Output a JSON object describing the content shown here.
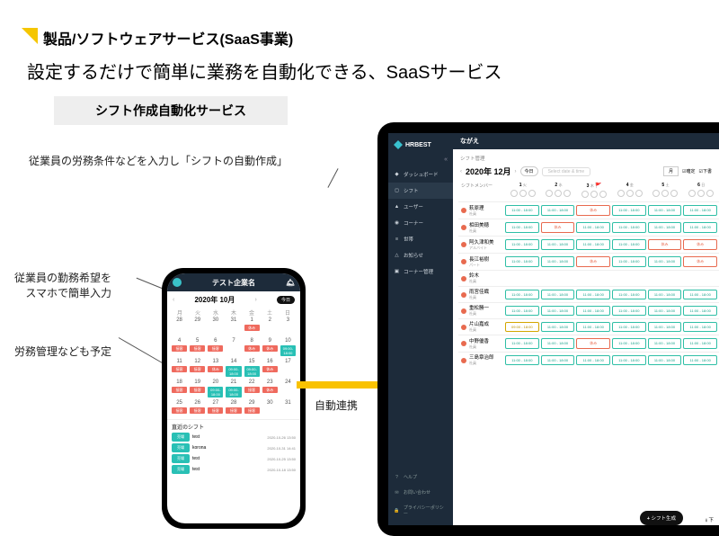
{
  "header": {
    "title": "製品/ソフトウェアサービス(SaaS事業)",
    "subtitle": "設定するだけで簡単に業務を自動化できる、SaaSサービス"
  },
  "service_box": "シフト作成自動化サービス",
  "annotations": {
    "a1": "従業員の労務条件などを入力し「シフトの自動作成」",
    "a2": "従業員の勤務希望を\nスマホで簡単入力",
    "a3": "労務管理なども予定",
    "link_label": "自動連携"
  },
  "phone": {
    "company": "テスト企業名",
    "month_label": "2020年 10月",
    "today_btn": "今日",
    "dow": [
      "月",
      "火",
      "水",
      "木",
      "金",
      "土",
      "日"
    ],
    "recent_title": "直近のシフト",
    "chips": {
      "work": "接客",
      "rest": "休み",
      "time": "09:00-18:00"
    },
    "recent": [
      {
        "tag": "売場",
        "name": "test",
        "ts": "2020-10-26 13:50"
      },
      {
        "tag": "売場",
        "name": "korona",
        "ts": "2020-10-31 14:41"
      },
      {
        "tag": "売場",
        "name": "test",
        "ts": "2020-10-25 13:50"
      },
      {
        "tag": "売場",
        "name": "test",
        "ts": "2020-10-18 13:50"
      }
    ]
  },
  "app": {
    "brand": "HRBEST",
    "nav": [
      {
        "icon": "◆",
        "label": "ダッシュボード"
      },
      {
        "icon": "◻",
        "label": "シフト"
      },
      {
        "icon": "▲",
        "label": "ユーザー"
      },
      {
        "icon": "◉",
        "label": "コーナー"
      },
      {
        "icon": "≡",
        "label": "世帯"
      },
      {
        "icon": "△",
        "label": "お知らせ"
      },
      {
        "icon": "▣",
        "label": "コーナー管理"
      }
    ],
    "footer_nav": [
      {
        "icon": "?",
        "label": "ヘルプ"
      },
      {
        "icon": "✉",
        "label": "お問い合わせ"
      },
      {
        "icon": "🔒",
        "label": "プライバシーポリシー"
      }
    ],
    "breadcrumb_group": "ながえ",
    "breadcrumb": "シフト管理",
    "month_label": "2020年 12月",
    "today": "今日",
    "select_placeholder": "Select date & time",
    "view_month": "月",
    "chk_fixed": "確定",
    "chk_draft": "下書",
    "col_emp": "シフトメンバー",
    "days": [
      {
        "d": "1",
        "w": "火"
      },
      {
        "d": "2",
        "w": "水"
      },
      {
        "d": "3",
        "w": "木"
      },
      {
        "d": "4",
        "w": "金"
      },
      {
        "d": "5",
        "w": "土"
      },
      {
        "d": "6",
        "w": "日"
      }
    ],
    "roles": {
      "sha": "社員",
      "alb": "アルバイト",
      "par": "パート"
    },
    "chip_work": "11:00 - 18:00",
    "chip_work2": "09:00 - 18:00",
    "chip_rest": "休み",
    "employees": [
      {
        "name": "萩原理",
        "role": "sha"
      },
      {
        "name": "相田美穂",
        "role": "sha"
      },
      {
        "name": "阿久津和美",
        "role": "alb"
      },
      {
        "name": "長江裕樹",
        "role": "par"
      },
      {
        "name": "鈴木",
        "role": "sha"
      },
      {
        "name": "雨宮佳織",
        "role": "sha"
      },
      {
        "name": "重松勝一",
        "role": "sha"
      },
      {
        "name": "片山嘉成",
        "role": "sha"
      },
      {
        "name": "中野優香",
        "role": "sha"
      },
      {
        "name": "三島章治郎",
        "role": "sha"
      }
    ],
    "fab": "シフト生成",
    "download": "下"
  }
}
